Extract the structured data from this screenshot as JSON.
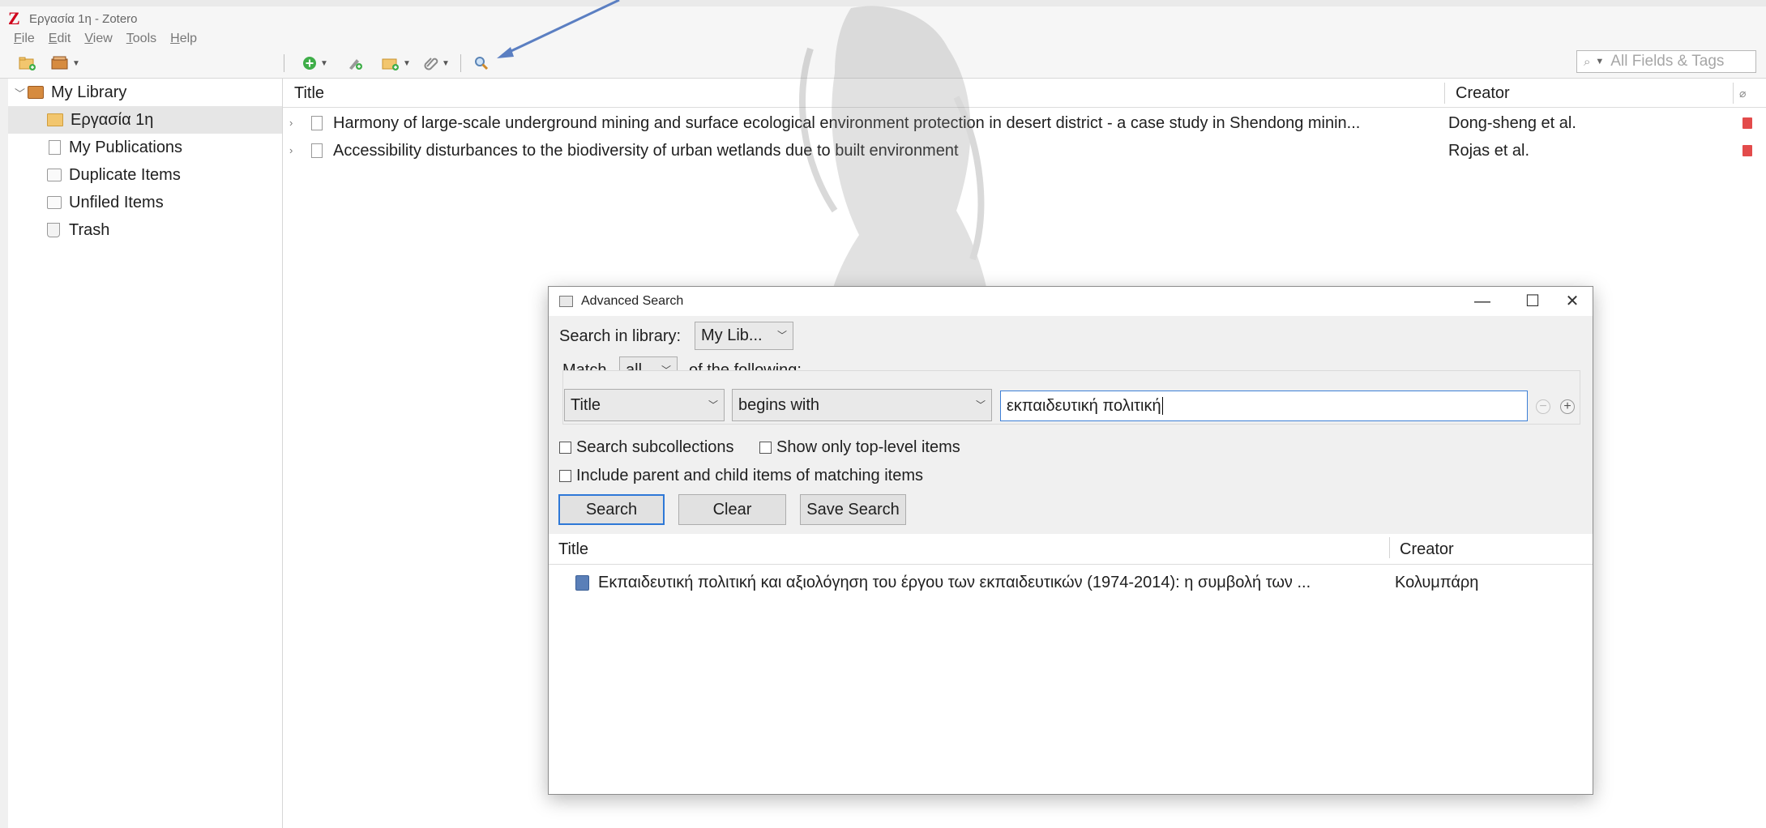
{
  "window": {
    "title": "Εργασία 1η - Zotero",
    "logo": "Z"
  },
  "menu": [
    {
      "label": "File",
      "mnemonic": "F",
      "rest": "ile"
    },
    {
      "label": "Edit",
      "mnemonic": "E",
      "rest": "dit"
    },
    {
      "label": "View",
      "mnemonic": "V",
      "rest": "iew"
    },
    {
      "label": "Tools",
      "mnemonic": "T",
      "rest": "ools"
    },
    {
      "label": "Help",
      "mnemonic": "H",
      "rest": "elp"
    }
  ],
  "toolbar": {
    "icons": [
      "new-collection-icon",
      "new-library-icon",
      "new-item-icon",
      "add-by-identifier-icon",
      "new-note-icon",
      "attachment-icon",
      "advanced-search-icon"
    ],
    "search_placeholder": "All Fields & Tags"
  },
  "collections": [
    {
      "label": "My Library",
      "icon": "library-icon",
      "expanded": true
    },
    {
      "label": "Εργασία 1η",
      "icon": "folder-icon",
      "selected": true
    },
    {
      "label": "My Publications",
      "icon": "publications-icon"
    },
    {
      "label": "Duplicate Items",
      "icon": "duplicate-icon"
    },
    {
      "label": "Unfiled Items",
      "icon": "unfiled-icon"
    },
    {
      "label": "Trash",
      "icon": "trash-icon"
    }
  ],
  "items_table": {
    "columns": {
      "title": "Title",
      "creator": "Creator"
    },
    "rows": [
      {
        "title": "Harmony of large-scale underground mining and surface ecological environment protection in desert district - a case study in Shendong minin...",
        "creator": "Dong-sheng et al."
      },
      {
        "title": "Accessibility disturbances to the biodiversity of urban wetlands due to built environment",
        "creator": "Rojas et al."
      }
    ]
  },
  "advanced_search": {
    "title": "Advanced Search",
    "search_in_label": "Search in library:",
    "library_value": "My Lib...",
    "match_label": "Match",
    "match_value": "all",
    "of_following": "of the following:",
    "condition": {
      "field": "Title",
      "operator": "begins with",
      "value": "εκπαιδευτική πολιτική"
    },
    "options": {
      "subcollections": "Search subcollections",
      "top_level": "Show only top-level items",
      "parent_child": "Include parent and child items of matching items"
    },
    "buttons": {
      "search": "Search",
      "clear": "Clear",
      "save": "Save Search"
    },
    "results": {
      "columns": {
        "title": "Title",
        "creator": "Creator"
      },
      "rows": [
        {
          "title": "Εκπαιδευτική πολιτική και αξιολόγηση του έργου των εκπαιδευτικών (1974-2014): η συμβολή των ...",
          "creator": "Κολυμπάρη"
        }
      ]
    }
  }
}
